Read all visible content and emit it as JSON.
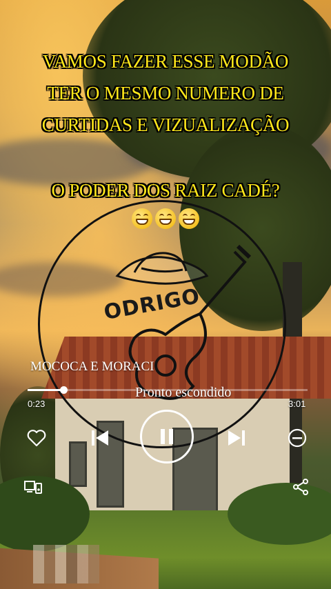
{
  "overlay": {
    "line1": "VAMOS FAZER ESSE MODÃO",
    "line2": "TER O MESMO NUMERO DE",
    "line3": "CURTIDAS E VIZUALIZAÇÃO",
    "line4": "O PODER DOS RAIZ CADÉ?",
    "emoji": "grinning-face-emoji",
    "emoji_count": 3,
    "text_color": "#ffe81a"
  },
  "logo": {
    "word": "ODRIGO",
    "icons": [
      "cowboy-hat-icon",
      "guitar-icon"
    ]
  },
  "player": {
    "artist": "MOCOCA E MORACI",
    "song_title": "Pronto escondido",
    "elapsed": "0:23",
    "duration": "3:01",
    "progress_fraction": 0.127,
    "controls": {
      "like": "heart-icon",
      "previous": "skip-previous-icon",
      "pause": "pause-icon",
      "next": "skip-next-icon",
      "remove": "minus-circle-icon",
      "device": "devices-icon",
      "share": "share-icon"
    }
  }
}
